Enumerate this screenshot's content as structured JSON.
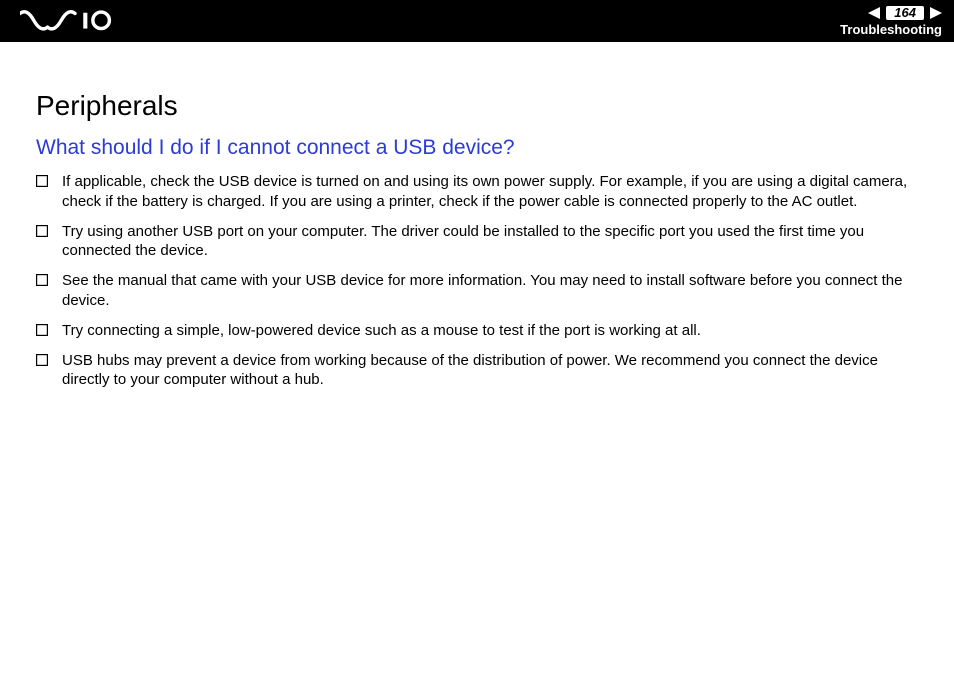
{
  "header": {
    "page_number": "164",
    "section": "Troubleshooting"
  },
  "content": {
    "title": "Peripherals",
    "question": "What should I do if I cannot connect a USB device?",
    "bullets": [
      "If applicable, check the USB device is turned on and using its own power supply. For example, if you are using a digital camera, check if the battery is charged. If you are using a printer, check if the power cable is connected properly to the AC outlet.",
      "Try using another USB port on your computer. The driver could be installed to the specific port you used the first time you connected the device.",
      "See the manual that came with your USB device for more information. You may need to install software before you connect the device.",
      "Try connecting a simple, low-powered device such as a mouse to test if the port is working at all.",
      "USB hubs may prevent a device from working because of the distribution of power. We recommend you connect the device directly to your computer without a hub."
    ]
  }
}
